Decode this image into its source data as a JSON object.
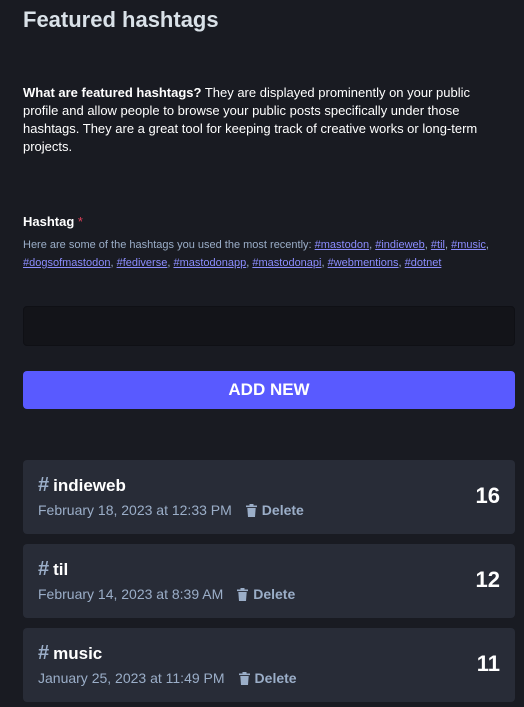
{
  "page": {
    "title": "Featured hashtags"
  },
  "intro": {
    "question": "What are featured hashtags?",
    "text": " They are displayed prominently on your public profile and allow people to browse your public posts specifically under those hashtags. They are a great tool for keeping track of creative works or long-term projects."
  },
  "form": {
    "label": "Hashtag",
    "required_mark": "*",
    "hint_prefix": "Here are some of the hashtags you used the most recently: ",
    "suggestions": [
      "#mastodon",
      "#indieweb",
      "#til",
      "#music",
      "#dogsofmastodon",
      "#fediverse",
      "#mastodonapp",
      "#mastodonapi",
      "#webmentions",
      "#dotnet"
    ],
    "input_value": "",
    "add_label": "Add new"
  },
  "tags": [
    {
      "name": "indieweb",
      "date": "February 18, 2023 at 12:33 PM",
      "delete_label": "Delete",
      "count": "16"
    },
    {
      "name": "til",
      "date": "February 14, 2023 at 8:39 AM",
      "delete_label": "Delete",
      "count": "12"
    },
    {
      "name": "music",
      "date": "January 25, 2023 at 11:49 PM",
      "delete_label": "Delete",
      "count": "11"
    }
  ],
  "icons": {
    "hash": "hash-icon",
    "trash": "trash-icon"
  },
  "colors": {
    "background": "#191b22",
    "card": "#282c37",
    "accent": "#595aff",
    "link": "#8c8dff",
    "muted": "#9baec8",
    "required": "#df405a"
  }
}
